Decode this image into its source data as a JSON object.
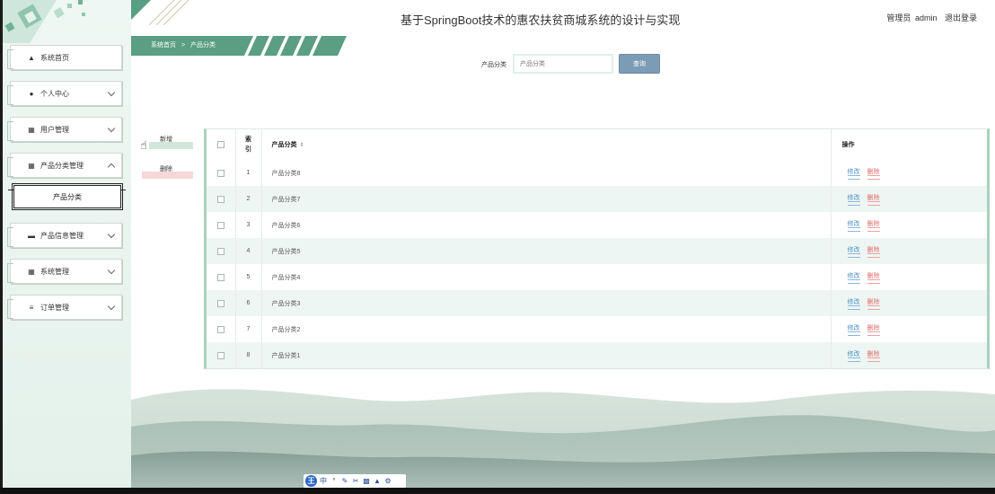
{
  "header": {
    "title": "基于SpringBoot技术的惠农扶贫商城系统的设计与实现",
    "user_role": "管理员",
    "username": "admin",
    "logout_label": "退出登录"
  },
  "breadcrumb": {
    "home": "系统首页",
    "separator": ">",
    "current": "产品分类"
  },
  "sidebar": {
    "items": [
      {
        "label": "系统首页",
        "icon": "home-icon"
      },
      {
        "label": "个人中心",
        "icon": "user-icon"
      },
      {
        "label": "用户管理",
        "icon": "grid-icon"
      },
      {
        "label": "产品分类管理",
        "icon": "grid-icon"
      },
      {
        "label": "产品信息管理",
        "icon": "monitor-icon"
      },
      {
        "label": "系统管理",
        "icon": "grid-icon"
      },
      {
        "label": "订单管理",
        "icon": "sliders-icon"
      }
    ],
    "active_sub": "产品分类"
  },
  "search": {
    "label": "产品分类",
    "placeholder": "产品分类",
    "button_label": "查询"
  },
  "actions": {
    "add_label": "新增",
    "delete_label": "删除"
  },
  "table": {
    "headers": {
      "index": "索引",
      "name": "产品分类",
      "ops": "操作"
    },
    "edit_label": "修改",
    "delete_label": "删除",
    "rows": [
      {
        "index": "1",
        "name": "产品分类8"
      },
      {
        "index": "2",
        "name": "产品分类7"
      },
      {
        "index": "3",
        "name": "产品分类6"
      },
      {
        "index": "4",
        "name": "产品分类5"
      },
      {
        "index": "5",
        "name": "产品分类4"
      },
      {
        "index": "6",
        "name": "产品分类3"
      },
      {
        "index": "7",
        "name": "产品分类2"
      },
      {
        "index": "8",
        "name": "产品分类1"
      }
    ]
  },
  "ime_bar": {
    "logo": "王",
    "mode": "中"
  },
  "colors": {
    "accent": "#5a9e83",
    "sidebar_bg": "#e8f4ef",
    "search_button": "#7c9cb6",
    "edit_link": "#4a90c8",
    "delete_link": "#e06b6b"
  }
}
